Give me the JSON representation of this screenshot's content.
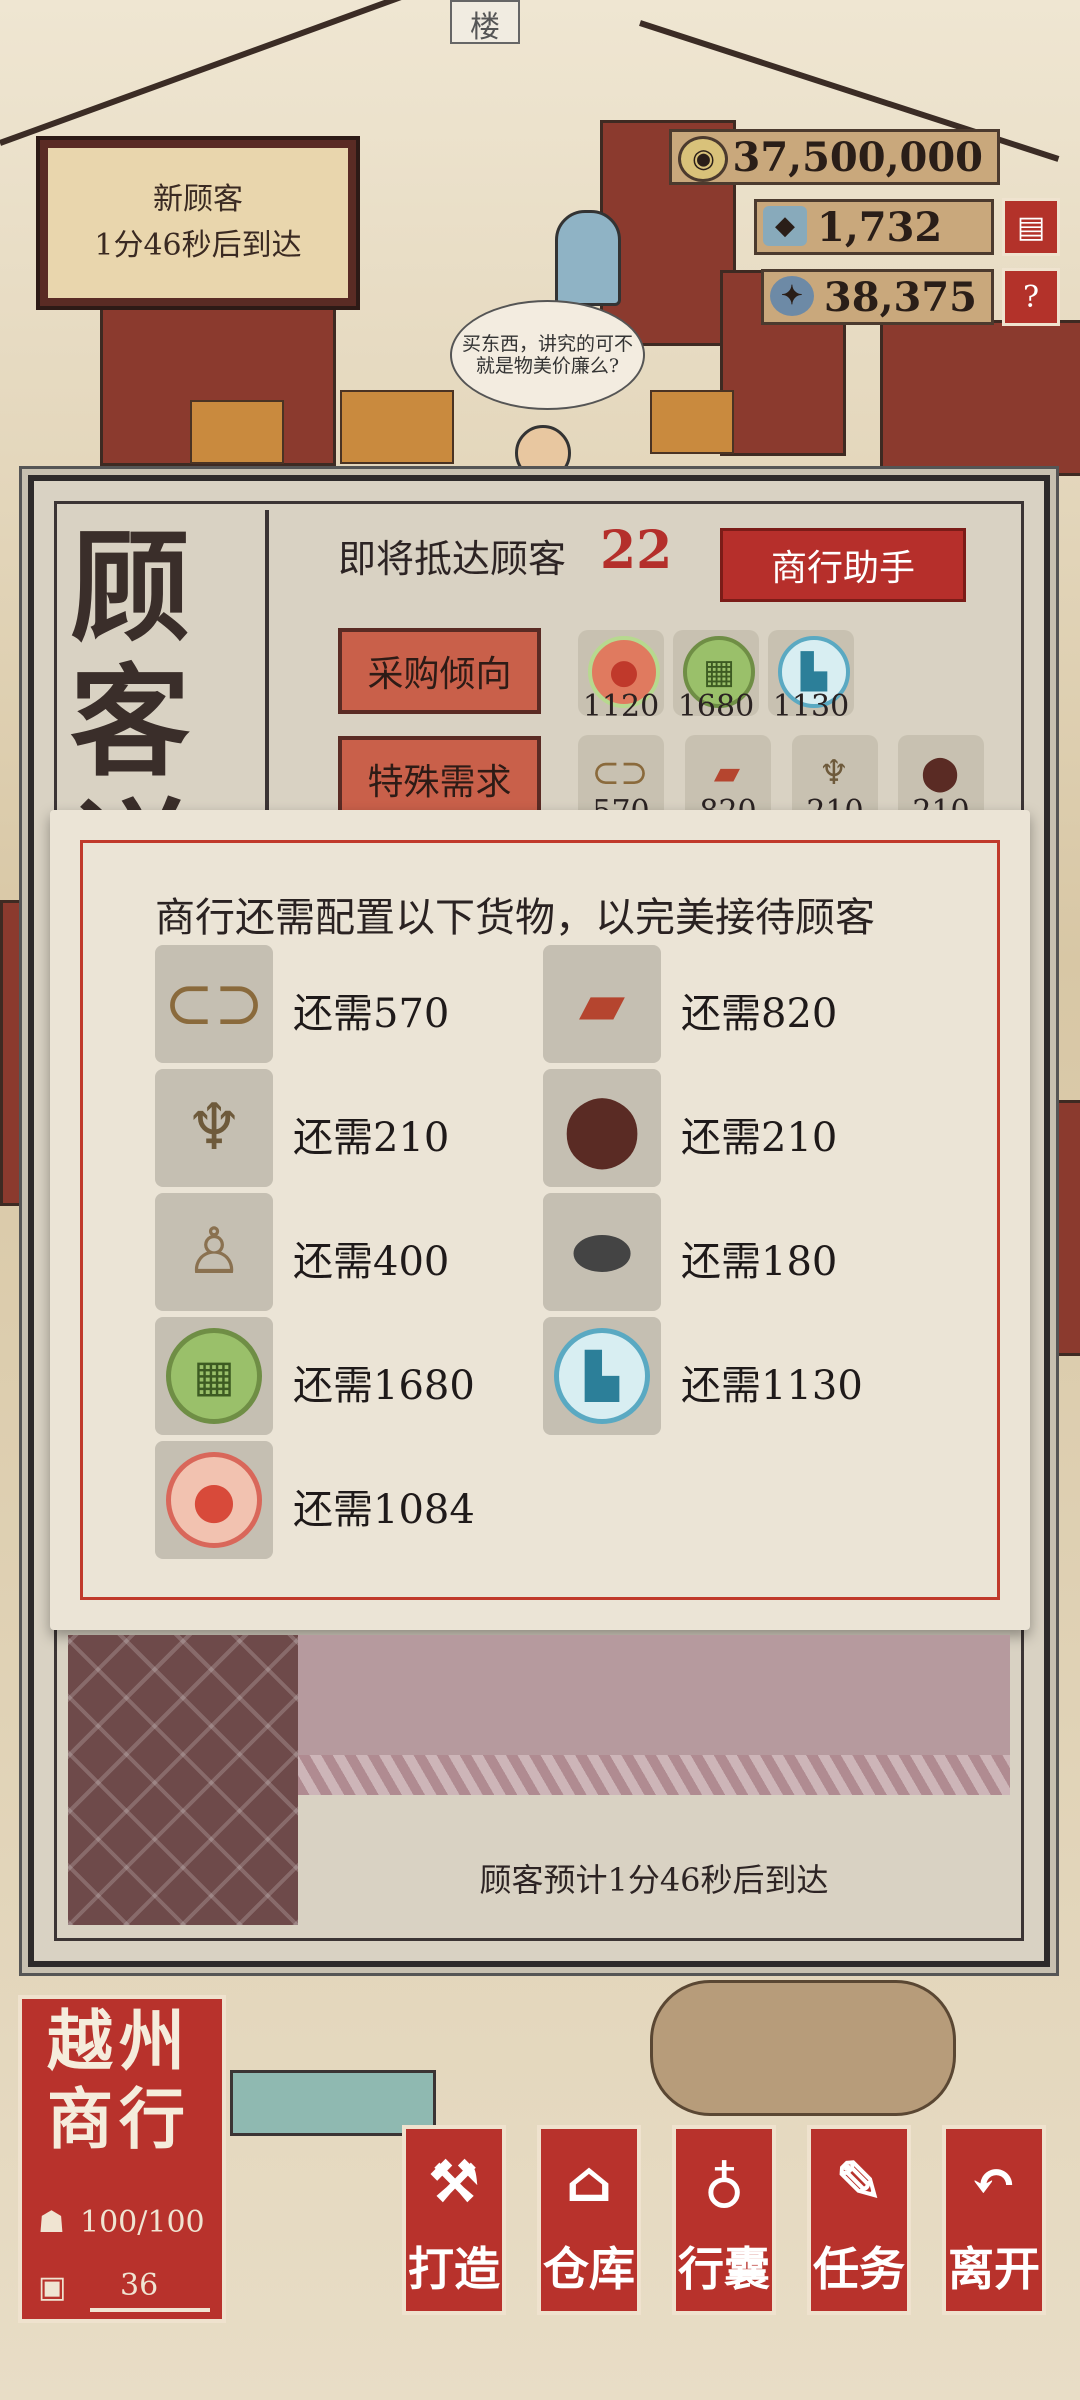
{
  "scene": {
    "building_sign": "楼",
    "speech_bubble": "买东西，讲究的可不就是物美价廉么?"
  },
  "resources": [
    {
      "name": "copper-coin",
      "value": "37,500,000"
    },
    {
      "name": "jade-note",
      "value": "1,732"
    },
    {
      "name": "ore",
      "value": "38,375"
    }
  ],
  "new_customer": {
    "title": "新顾客",
    "time": "1分46秒后到达"
  },
  "panel": {
    "title": "顾客详",
    "arriving_label": "即将抵达顾客",
    "arriving_count": "22",
    "helper_button": "商行助手",
    "purchase_tendency": "采购倾向",
    "special_demand": "特殊需求",
    "tendency_items": [
      {
        "icon": "persimmon-icon",
        "value": "1120"
      },
      {
        "icon": "ledger-icon",
        "value": "1680"
      },
      {
        "icon": "boot-icon",
        "value": "1130"
      }
    ],
    "demand_items": [
      {
        "icon": "shoes-icon",
        "value": "570"
      },
      {
        "icon": "cake-icon",
        "value": "820"
      },
      {
        "icon": "lamp-icon",
        "value": "210"
      },
      {
        "icon": "jar-icon",
        "value": "210"
      }
    ],
    "footer_text": "顾客预计1分46秒后到达"
  },
  "popup": {
    "title": "商行还需配置以下货物，以完美接待顾客",
    "items": [
      {
        "icon": "shoes-icon",
        "label": "还需570"
      },
      {
        "icon": "cake-icon",
        "label": "还需820"
      },
      {
        "icon": "lamp-icon",
        "label": "还需210"
      },
      {
        "icon": "jar-icon",
        "label": "还需210"
      },
      {
        "icon": "figurine-icon",
        "label": "还需400"
      },
      {
        "icon": "wok-icon",
        "label": "还需180"
      },
      {
        "icon": "ledger-icon",
        "label": "还需1680"
      },
      {
        "icon": "boot-icon",
        "label": "还需1130"
      },
      {
        "icon": "persimmon-icon",
        "label": "还需1084"
      }
    ]
  },
  "city": {
    "title": "越州商行",
    "population": "100/100",
    "level": "36"
  },
  "nav": [
    {
      "label": "打造",
      "icon": "forge-icon"
    },
    {
      "label": "仓库",
      "icon": "warehouse-icon"
    },
    {
      "label": "行囊",
      "icon": "bundle-icon"
    },
    {
      "label": "任务",
      "icon": "scroll-icon"
    },
    {
      "label": "离开",
      "icon": "return-icon"
    }
  ],
  "colors": {
    "accent_red": "#b62f2b",
    "panel_bg": "#d9d2c3",
    "popup_bg": "#ebe4d6"
  }
}
